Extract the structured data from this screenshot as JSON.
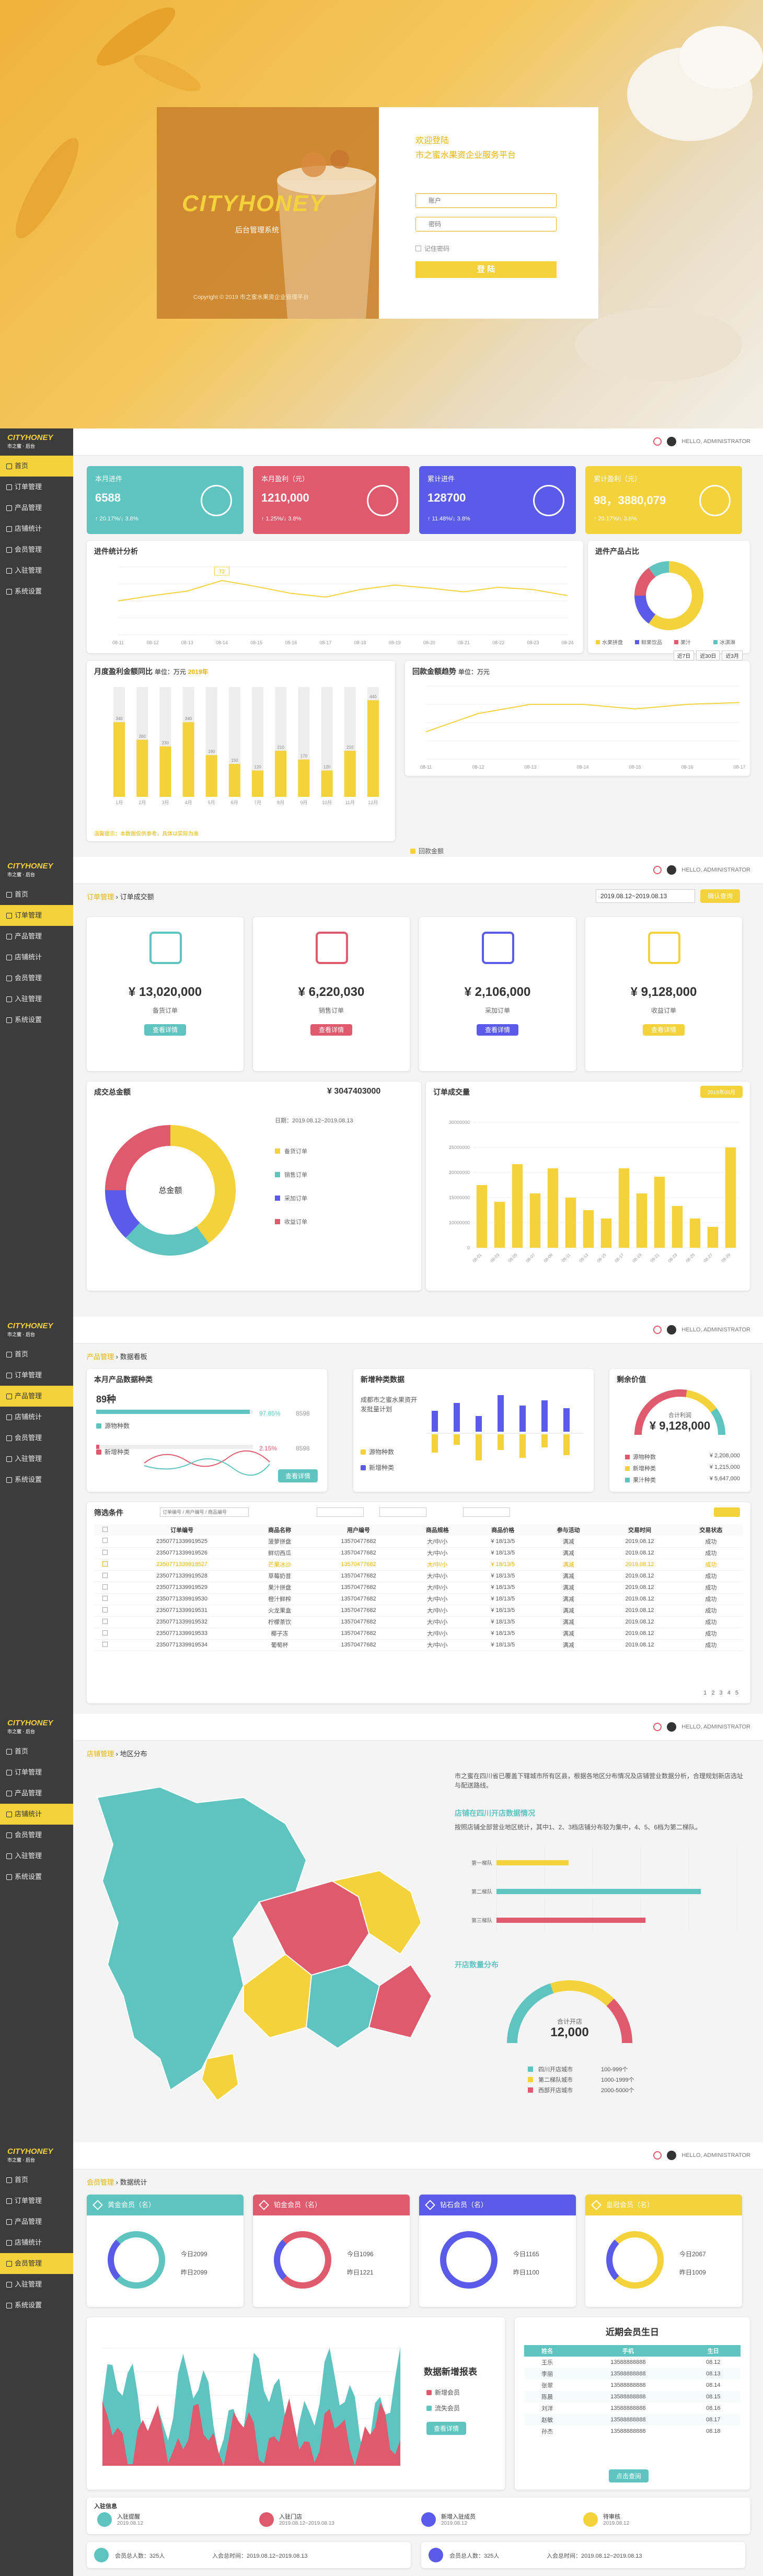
{
  "colors": {
    "yellow": "#f4d23c",
    "teal": "#5fc4c0",
    "pink": "#e05a6d",
    "blue": "#5b5bea",
    "dark": "#3c3c3c"
  },
  "login": {
    "brand": "CITYHONEY",
    "system": "后台管理系统",
    "copyright": "Copyright © 2019 市之蜜水果资企业管理平台",
    "welcome": "欢迎登陆",
    "platform": "市之蜜水果资企业服务平台",
    "user_placeholder": "账户",
    "pass_placeholder": "密码",
    "remember": "记住密码",
    "submit": "登 陆"
  },
  "shell": {
    "logo": "CITYHONEY",
    "logo_sub": "市之蜜 · 后台",
    "user": "HELLO, ADMINISTRATOR",
    "nav": [
      "首页",
      "订单管理",
      "产品管理",
      "店铺统计",
      "会员管理",
      "入驻管理",
      "系统设置"
    ]
  },
  "home": {
    "kpis": [
      {
        "title": "本月进件",
        "value": "6588",
        "sub": "↑ 20.17%/↓ 3.8%"
      },
      {
        "title": "本月盈利（元）",
        "value": "1210,000",
        "sub": "↑ 1.25%/↓ 3.8%"
      },
      {
        "title": "累计进件",
        "value": "128700",
        "sub": "↑ 11.48%/↓ 3.8%"
      },
      {
        "title": "累计盈利（元）",
        "value": "98，3880,079",
        "sub": "↑ 20.17%/↓ 3.8%"
      }
    ],
    "progress_title": "进件统计分析",
    "progress_tooltip": "72",
    "progress_x": [
      "08-11",
      "08-12",
      "08-13",
      "08-14",
      "08-15",
      "08-16",
      "08-17",
      "08-18",
      "08-19",
      "08-20",
      "08-21",
      "08-22",
      "08-23",
      "08-24"
    ],
    "progress_y": [
      45,
      52,
      58,
      72,
      64,
      55,
      50,
      60,
      66,
      62,
      57,
      63,
      60,
      52
    ],
    "pie_title": "进件产品占比",
    "pie_legend": [
      "水果拼盘",
      "鲜果饮品",
      "果汁",
      "冰淇淋"
    ],
    "pie_values": [
      60,
      15,
      15,
      10
    ],
    "monthly_title": "月度盈利金额同比",
    "monthly_unit": "单位：万元",
    "monthly_legend": "2019年",
    "monthly_months": [
      "1月",
      "2月",
      "3月",
      "4月",
      "5月",
      "6月",
      "7月",
      "8月",
      "9月",
      "10月",
      "11月",
      "12月"
    ],
    "monthly_values": [
      340,
      260,
      230,
      340,
      190,
      150,
      120,
      210,
      170,
      120,
      210,
      440
    ],
    "monthly_note": "温馨提示：本数据仅供参考，具体以实际为准",
    "trend_title": "回款金额趋势",
    "trend_unit": "单位：万元",
    "trend_tabs": [
      "近7日",
      "近30日",
      "近3月"
    ],
    "trend_x": [
      "08-11",
      "08-12",
      "08-13",
      "08-14",
      "08-15",
      "08-16",
      "08-17"
    ],
    "trend_y": [
      3,
      5,
      6,
      6,
      5.5,
      6,
      6.2
    ],
    "trend_legend": "回款金额"
  },
  "orders": {
    "crumb_a": "订单管理",
    "crumb_b": "订单成交额",
    "date_range": "2019.08.12~2019.08.13",
    "confirm": "确认查询",
    "summary": [
      {
        "value": "¥ 13,020,000",
        "label": "备货订单",
        "btn": "查看详情",
        "color": "#5fc4c0",
        "icon": "cart-icon"
      },
      {
        "value": "¥ 6,220,030",
        "label": "销售订单",
        "btn": "查看详情",
        "color": "#e05a6d",
        "icon": "clipboard-icon"
      },
      {
        "value": "¥ 2,106,000",
        "label": "采加订单",
        "btn": "查看详情",
        "color": "#5b5bea",
        "icon": "money-bag-icon"
      },
      {
        "value": "¥ 9,128,000",
        "label": "收益订单",
        "btn": "查看详情",
        "color": "#f4d23c",
        "icon": "receipt-icon"
      }
    ],
    "donut_title": "成交总金额",
    "donut_total": "¥ 3047403000",
    "donut_center": "总金额",
    "donut_date": "日期：2019.08.12~2019.08.13",
    "donut_legend": [
      "备货订单",
      "销售订单",
      "采加订单",
      "收益订单"
    ],
    "donut_values": [
      40,
      22,
      13,
      25
    ],
    "bar_title": "订单成交量",
    "bar_btn": "2019年08月",
    "bar_y_labels": [
      "30000000",
      "25000000",
      "20000000",
      "15000000",
      "10000000",
      "0"
    ],
    "bar_x": [
      "08-01",
      "08-03",
      "08-05",
      "08-07",
      "08-09",
      "08-11",
      "08-13",
      "08-15",
      "08-17",
      "08-19",
      "08-21",
      "08-23",
      "08-25",
      "08-27",
      "08-29"
    ],
    "bar_values": [
      15,
      11,
      20,
      13,
      19,
      12,
      9,
      7,
      19,
      13,
      17,
      10,
      7,
      5,
      24
    ]
  },
  "products": {
    "crumb_a": "产品管理",
    "crumb_b": "数据看板",
    "kind_title": "本月产品数据种类",
    "kind_big": "89种",
    "kind_rows": [
      {
        "label": "源物种数",
        "pct": "97.85%",
        "num": "8598"
      },
      {
        "label": "新增种类",
        "pct": "2.15%",
        "num": "8598"
      }
    ],
    "kind_btn": "查看详情",
    "new_title": "新增种类数据",
    "new_desc": "成都市之蜜水果资开发批量计划",
    "new_legend": [
      "源物种数",
      "新增种类"
    ],
    "profit_title": "剩余价值",
    "profit_total_label": "合计利润",
    "profit_total": "¥ 9,128,000",
    "profit_rows": [
      {
        "label": "源物种数",
        "val": "¥ 2,208,000"
      },
      {
        "label": "新增种类",
        "val": "¥ 1,215,000"
      },
      {
        "label": "果汁种类",
        "val": "¥ 5,647,000"
      }
    ],
    "filter_title": "筛选条件",
    "filter_placeholder": "订单编号 / 用户编号 / 商品编号",
    "table_head": [
      "订单编号",
      "商品名称",
      "用户编号",
      "商品规格",
      "商品价格",
      "参与活动",
      "交易时间",
      "交易状态"
    ],
    "rows": [
      [
        "2350771339919525",
        "菠萝拼盘",
        "13570477682",
        "大/中/小",
        "¥ 18/13/5",
        "满减",
        "2019.08.12",
        "成功"
      ],
      [
        "2350771339919526",
        "鲜切西瓜",
        "13570477682",
        "大/中/小",
        "¥ 18/13/5",
        "满减",
        "2019.08.12",
        "成功"
      ],
      [
        "2350771339919527",
        "芒果冰沙",
        "13570477682",
        "大/中/小",
        "¥ 18/13/5",
        "满减",
        "2019.08.12",
        "成功"
      ],
      [
        "2350771339919528",
        "草莓奶昔",
        "13570477682",
        "大/中/小",
        "¥ 18/13/5",
        "满减",
        "2019.08.12",
        "成功"
      ],
      [
        "2350771339919529",
        "果汁拼盘",
        "13570477682",
        "大/中/小",
        "¥ 18/13/5",
        "满减",
        "2019.08.12",
        "成功"
      ],
      [
        "2350771339919530",
        "橙汁鲜榨",
        "13570477682",
        "大/中/小",
        "¥ 18/13/5",
        "满减",
        "2019.08.12",
        "成功"
      ],
      [
        "2350771339919531",
        "火龙果盒",
        "13570477682",
        "大/中/小",
        "¥ 18/13/5",
        "满减",
        "2019.08.12",
        "成功"
      ],
      [
        "2350771339919532",
        "柠檬茶饮",
        "13570477682",
        "大/中/小",
        "¥ 18/13/5",
        "满减",
        "2019.08.12",
        "成功"
      ],
      [
        "2350771339919533",
        "椰子冻",
        "13570477682",
        "大/中/小",
        "¥ 18/13/5",
        "满减",
        "2019.08.12",
        "成功"
      ],
      [
        "2350771339919534",
        "葡萄杯",
        "13570477682",
        "大/中/小",
        "¥ 18/13/5",
        "满减",
        "2019.08.12",
        "成功"
      ]
    ],
    "pager": "1 2 3 4 5"
  },
  "stores": {
    "crumb_a": "店铺管理",
    "crumb_b": "地区分布",
    "intro": "市之蜜在四川省已覆盖下辖城市所有区县，根据各地区分布情况及店铺营业数据分析，合理规划新店选址与配送路线。",
    "dist_title": "店铺在四川开店数据情况",
    "dist_desc": "按照店铺全部营业地区统计，其中1、2、3档店铺分布较为集中，4、5、6档为第二梯队。",
    "dist_rows": [
      "第一梯队",
      "第二梯队",
      "第三梯队"
    ],
    "dist_values": [
      30,
      85,
      62
    ],
    "open_title": "开店数量分布",
    "open_total_label": "合计开店",
    "open_total": "12,000",
    "open_legend": [
      {
        "label": "四川开店城市",
        "val": "100-999个"
      },
      {
        "label": "第二梯队城市",
        "val": "1000-1999个"
      },
      {
        "label": "西部开店城市",
        "val": "2000-5000个"
      }
    ]
  },
  "members": {
    "crumb_a": "会员管理",
    "crumb_b": "数据统计",
    "cards": [
      {
        "title": "黄金会员（名）",
        "a": "今日2099",
        "b": "昨日2099",
        "color": "#5fc4c0"
      },
      {
        "title": "铂金会员（名）",
        "a": "今日1096",
        "b": "昨日1221",
        "color": "#e05a6d"
      },
      {
        "title": "钻石会员（名）",
        "a": "今日1165",
        "b": "昨日1100",
        "color": "#5b5bea"
      },
      {
        "title": "皇冠会员（名）",
        "a": "今日2067",
        "b": "昨日1009",
        "color": "#f4d23c"
      }
    ],
    "area_title": "数据新增报表",
    "area_legend": [
      "新增会员",
      "流失会员"
    ],
    "area_btn": "查看详情",
    "birthday_title": "近期会员生日",
    "birthday_head": [
      "姓名",
      "手机",
      "生日"
    ],
    "birthday_rows": [
      [
        "王乐",
        "13588888888",
        "08.12"
      ],
      [
        "李丽",
        "13588888888",
        "08.13"
      ],
      [
        "张翠",
        "13588888888",
        "08.14"
      ],
      [
        "陈晨",
        "13588888888",
        "08.15"
      ],
      [
        "刘洋",
        "13588888888",
        "08.16"
      ],
      [
        "赵敏",
        "13588888888",
        "08.17"
      ],
      [
        "孙杰",
        "13588888888",
        "08.18"
      ]
    ],
    "birthday_btn": "点击查阅",
    "enter_title": "入驻信息",
    "enter_items": [
      {
        "a": "入驻提醒",
        "b": "2019.08.12"
      },
      {
        "a": "入驻门店",
        "b": "2019.08.12~2019.08.13"
      },
      {
        "a": "新增入驻成员",
        "b": "2019.08.12"
      },
      {
        "a": "待审核",
        "b": "2019.08.12"
      }
    ],
    "footer": [
      {
        "a": "会员总人数：325人",
        "b": "入会总时间：2019.08.12~2019.08.13"
      },
      {
        "a": "会员总人数：325人",
        "b": "入会总时间：2019.08.12~2019.08.13"
      }
    ]
  }
}
